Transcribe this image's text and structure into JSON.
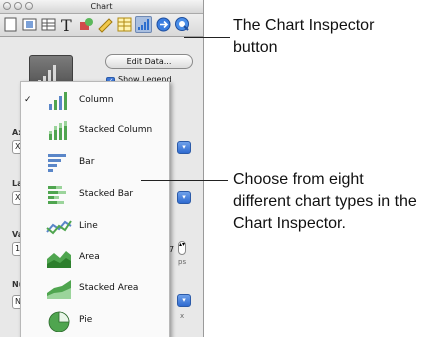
{
  "window": {
    "title": "Chart"
  },
  "toolbar": {
    "buttons": [
      {
        "name": "document-inspector",
        "icon": "document-icon"
      },
      {
        "name": "layout-inspector",
        "icon": "layout-icon"
      },
      {
        "name": "table-inspector",
        "icon": "table-icon"
      },
      {
        "name": "text-inspector",
        "icon": "text-icon"
      },
      {
        "name": "graphic-inspector",
        "icon": "graphic-icon"
      },
      {
        "name": "metrics-inspector",
        "icon": "ruler-icon"
      },
      {
        "name": "cell-inspector",
        "icon": "grid-icon"
      },
      {
        "name": "chart-inspector",
        "icon": "bar-chart-icon",
        "active": true
      },
      {
        "name": "hyperlink-inspector",
        "icon": "link-icon"
      },
      {
        "name": "quicktime-inspector",
        "icon": "quicktime-icon"
      }
    ]
  },
  "chart_panel": {
    "edit_data_label": "Edit Data...",
    "show_legend_label": "Show Legend",
    "show_legend_checked": true,
    "sections": [
      {
        "label": "Axe",
        "field": "X"
      },
      {
        "label": "Lab",
        "field": "X"
      },
      {
        "label": "Val",
        "field": "10",
        "stepper_value": "7",
        "sub_left": "M",
        "sub_right": "ps"
      },
      {
        "label": "Nu",
        "field": "No",
        "sub_right": "x"
      }
    ]
  },
  "chart_type_menu": {
    "selected": "Column",
    "items": [
      {
        "label": "Column",
        "icon": "column-chart-icon",
        "checked": true
      },
      {
        "label": "Stacked Column",
        "icon": "stacked-column-chart-icon"
      },
      {
        "label": "Bar",
        "icon": "bar-chart-icon"
      },
      {
        "label": "Stacked Bar",
        "icon": "stacked-bar-chart-icon"
      },
      {
        "label": "Line",
        "icon": "line-chart-icon"
      },
      {
        "label": "Area",
        "icon": "area-chart-icon"
      },
      {
        "label": "Stacked Area",
        "icon": "stacked-area-chart-icon"
      },
      {
        "label": "Pie",
        "icon": "pie-chart-icon"
      }
    ]
  },
  "callouts": [
    {
      "text": "The Chart Inspector button"
    },
    {
      "text": "Choose from eight different chart types in the Chart Inspector."
    }
  ],
  "colors": {
    "selected_button": "#a9bfe0",
    "checkbox": "#3f78d8",
    "icon_green": "#4fa54f",
    "icon_blue": "#5a86c8"
  }
}
